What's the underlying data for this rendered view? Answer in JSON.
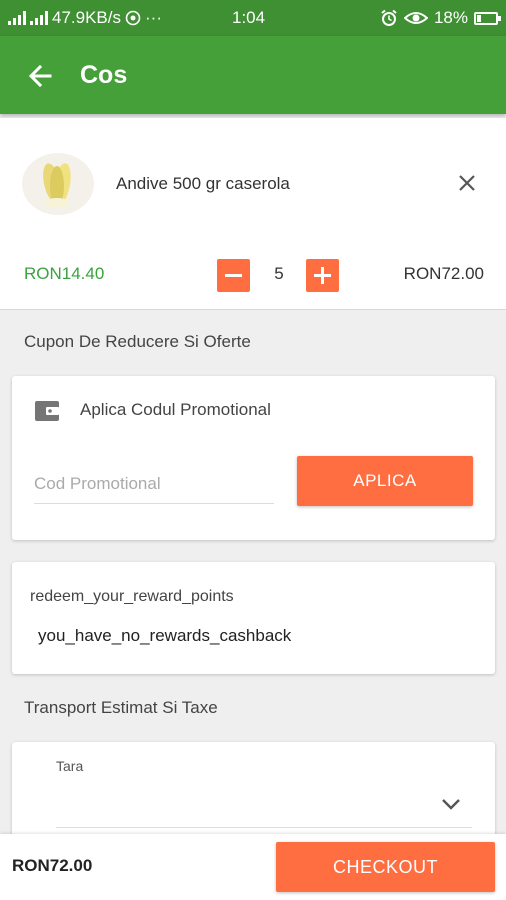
{
  "status_bar": {
    "network_speed": "47.9KB/s",
    "more_indicator": "···",
    "time": "1:04",
    "battery_percent": "18%",
    "battery_level": 0.18
  },
  "app_bar": {
    "title": "Cos",
    "back_icon": "arrow-left-icon"
  },
  "cart_item": {
    "name": "Andive 500 gr caserola",
    "unit_price": "RON14.40",
    "quantity": "5",
    "line_total": "RON72.00",
    "remove_icon": "close-icon"
  },
  "coupon_section": {
    "title": "Cupon De Reducere Si Oferte",
    "card_title": "Aplica Codul Promotional",
    "input_placeholder": "Cod Promotional",
    "input_value": "",
    "apply_label": "APLICA"
  },
  "reward_section": {
    "title": "redeem_your_reward_points",
    "text": "you_have_no_rewards_cashback"
  },
  "shipping_section": {
    "title": "Transport Estimat Si Taxe",
    "country_label": "Tara",
    "country_value": ""
  },
  "bottom_bar": {
    "total": "RON72.00",
    "checkout_label": "CHECKOUT"
  },
  "colors": {
    "status_bar": "#3f8f33",
    "app_bar": "#45a03a",
    "accent": "#ff6e40",
    "price_green": "#3aa33c"
  }
}
